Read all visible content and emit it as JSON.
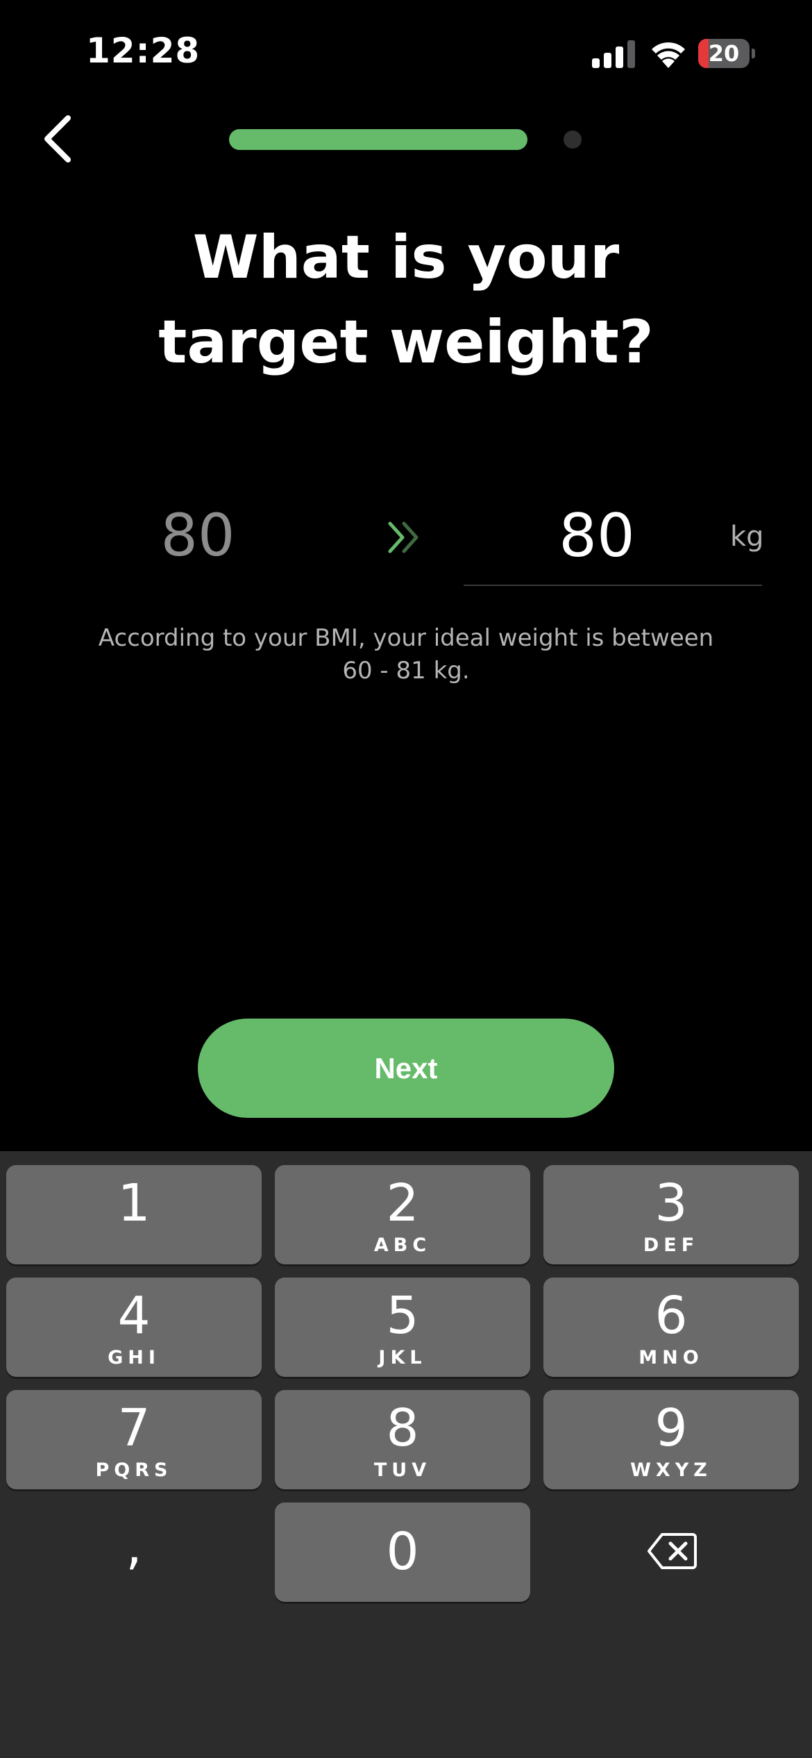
{
  "status_bar": {
    "time": "12:28",
    "battery_percent": 20,
    "battery_label": "20",
    "signal_bars_active": 3,
    "signal_bars_total": 4
  },
  "progress": {
    "fraction": 0.93
  },
  "title": "What is your\ntarget weight?",
  "weight": {
    "current": "80",
    "target": "80",
    "unit": "kg"
  },
  "bmi_note": "According to your BMI, your ideal weight is between\n60 - 81 kg.",
  "next_label": "Next",
  "keyboard": {
    "keys": [
      {
        "digit": "1",
        "letters": ""
      },
      {
        "digit": "2",
        "letters": "ABC"
      },
      {
        "digit": "3",
        "letters": "DEF"
      },
      {
        "digit": "4",
        "letters": "GHI"
      },
      {
        "digit": "5",
        "letters": "JKL"
      },
      {
        "digit": "6",
        "letters": "MNO"
      },
      {
        "digit": "7",
        "letters": "PQRS"
      },
      {
        "digit": "8",
        "letters": "TUV"
      },
      {
        "digit": "9",
        "letters": "WXYZ"
      },
      {
        "digit": "0",
        "letters": ""
      }
    ],
    "comma": ","
  },
  "colors": {
    "accent": "#66bb6a",
    "background": "#000000",
    "keyboard_bg": "#2c2c2c",
    "key_bg": "#6a6a6a",
    "muted_text": "#8c8c8c"
  },
  "icons": {
    "back": "chevron-left-icon",
    "arrow": "double-chevron-right-icon",
    "delete": "backspace-icon",
    "wifi": "wifi-icon",
    "signal": "cellular-signal-icon",
    "battery": "battery-icon"
  }
}
